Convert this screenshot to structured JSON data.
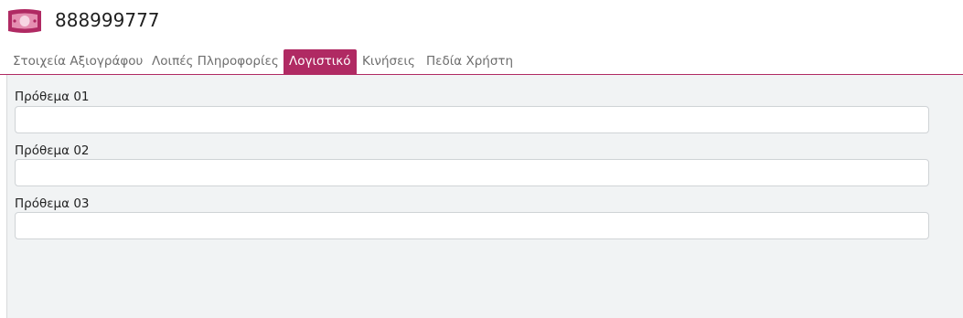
{
  "header": {
    "title": "888999777",
    "icon": "banknote-icon",
    "accent_color": "#b02a63"
  },
  "tabs": [
    {
      "label": "Στοιχεία Αξιογράφου",
      "active": false
    },
    {
      "label": "Λοιπές Πληροφορίες",
      "active": false
    },
    {
      "label": "Λογιστικό",
      "active": true
    },
    {
      "label": "Κινήσεις",
      "active": false
    },
    {
      "label": "Πεδία Χρήστη",
      "active": false
    }
  ],
  "fields": [
    {
      "label": "Πρόθεμα 01",
      "value": ""
    },
    {
      "label": "Πρόθεμα 02",
      "value": ""
    },
    {
      "label": "Πρόθεμα 03",
      "value": ""
    }
  ]
}
